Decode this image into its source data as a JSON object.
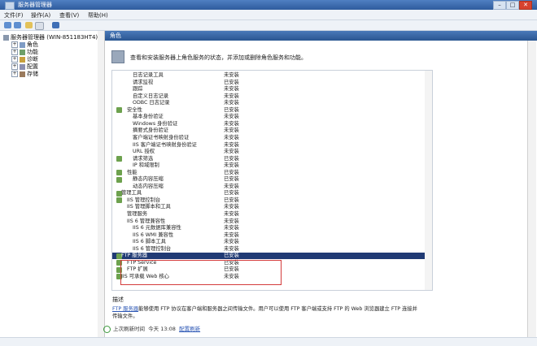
{
  "window": {
    "title": "服务器管理器",
    "minimize": "–",
    "maximize": "□",
    "close": "✕"
  },
  "menu": [
    "文件(F)",
    "操作(A)",
    "查看(V)",
    "帮助(H)"
  ],
  "tree": [
    "服务器管理器 (WIN-851183HT4)",
    "角色",
    "功能",
    "诊断",
    "配置",
    "存储"
  ],
  "panel": {
    "header": "角色",
    "intro": "查看和安装服务器上角色服务的状态，并添加或删除角色服务和功能。"
  },
  "services": [
    {
      "name": "日志记录工具",
      "status": "未安装",
      "indent": 25,
      "icon": false
    },
    {
      "name": "请求监视",
      "status": "已安装",
      "indent": 25,
      "icon": false
    },
    {
      "name": "跟踪",
      "status": "未安装",
      "indent": 25,
      "icon": false
    },
    {
      "name": "自定义日志记录",
      "status": "未安装",
      "indent": 25,
      "icon": false
    },
    {
      "name": "ODBC 日志记录",
      "status": "未安装",
      "indent": 25,
      "icon": false
    },
    {
      "name": "安全性",
      "status": "已安装",
      "indent": 18,
      "icon": true
    },
    {
      "name": "基本身份验证",
      "status": "未安装",
      "indent": 25,
      "icon": false
    },
    {
      "name": "Windows 身份验证",
      "status": "未安装",
      "indent": 25,
      "icon": false
    },
    {
      "name": "摘要式身份验证",
      "status": "未安装",
      "indent": 25,
      "icon": false
    },
    {
      "name": "客户端证书映射身份验证",
      "status": "未安装",
      "indent": 25,
      "icon": false
    },
    {
      "name": "IIS 客户端证书映射身份验证",
      "status": "未安装",
      "indent": 25,
      "icon": false
    },
    {
      "name": "URL 授权",
      "status": "未安装",
      "indent": 25,
      "icon": false
    },
    {
      "name": "请求筛选",
      "status": "已安装",
      "indent": 25,
      "icon": true
    },
    {
      "name": "IP 和域限制",
      "status": "未安装",
      "indent": 25,
      "icon": false
    },
    {
      "name": "性能",
      "status": "已安装",
      "indent": 18,
      "icon": true
    },
    {
      "name": "静态内容压缩",
      "status": "已安装",
      "indent": 25,
      "icon": true
    },
    {
      "name": "动态内容压缩",
      "status": "未安装",
      "indent": 25,
      "icon": false
    },
    {
      "name": "管理工具",
      "status": "已安装",
      "indent": 11,
      "icon": true
    },
    {
      "name": "IIS 管理控制台",
      "status": "已安装",
      "indent": 18,
      "icon": true
    },
    {
      "name": "IIS 管理脚本和工具",
      "status": "未安装",
      "indent": 18,
      "icon": false
    },
    {
      "name": "管理服务",
      "status": "未安装",
      "indent": 18,
      "icon": false
    },
    {
      "name": "IIS 6 管理兼容性",
      "status": "未安装",
      "indent": 18,
      "icon": false
    },
    {
      "name": "IIS 6 元数据库兼容性",
      "status": "未安装",
      "indent": 25,
      "icon": false
    },
    {
      "name": "IIS 6 WMI 兼容性",
      "status": "未安装",
      "indent": 25,
      "icon": false
    },
    {
      "name": "IIS 6 脚本工具",
      "status": "未安装",
      "indent": 25,
      "icon": false
    },
    {
      "name": "IIS 6 管理控制台",
      "status": "未安装",
      "indent": 25,
      "icon": false
    },
    {
      "name": "FTP 服务器",
      "status": "已安装",
      "indent": 11,
      "icon": true,
      "selected": true
    },
    {
      "name": "FTP Service",
      "status": "已安装",
      "indent": 18,
      "icon": true
    },
    {
      "name": "FTP 扩展",
      "status": "已安装",
      "indent": 18,
      "icon": true
    },
    {
      "name": "IIS 可承载 Web 核心",
      "status": "未安装",
      "indent": 11,
      "icon": true
    }
  ],
  "description": {
    "label": "描述",
    "link": "FTP 服务器",
    "text": "能够使用 FTP 协议在客户端和服务器之间传输文件。用户可以使用 FTP 客户端或支持 FTP 的 Web 浏览器建立 FTP 连接并传输文件。"
  },
  "refresh": {
    "label": "上次刷新时间",
    "time": "今天 13:08",
    "link": "配置刷新"
  },
  "colors": {
    "titlebar": "#2f5c9d",
    "selected_row": "#203a74",
    "highlight_box": "#d33b3b",
    "installed_icon": "#6da14e"
  }
}
